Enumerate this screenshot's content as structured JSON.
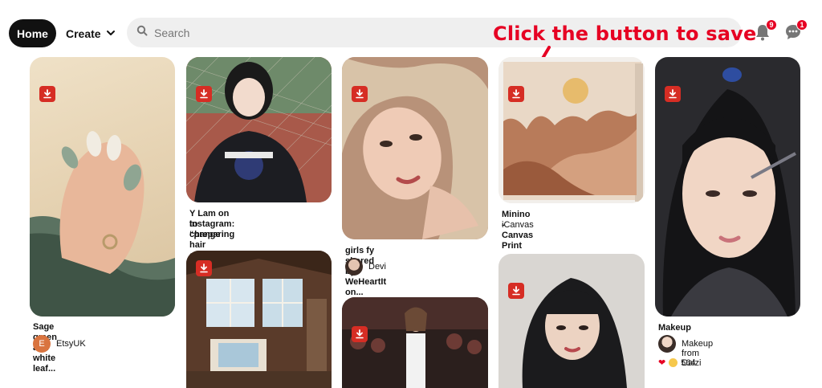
{
  "header": {
    "home_label": "Home",
    "create_label": "Create",
    "search_placeholder": "Search",
    "callout": "Click the button to save",
    "notifications_count": "9",
    "messages_count": "1"
  },
  "pins": [
    {
      "id": "pin1",
      "title": "Sage green and white leaf...",
      "source": "EtsyUK",
      "avatar_letter": "E"
    },
    {
      "id": "pin2",
      "title_line1": "Y Lam on Instagram: “preparing",
      "title_line2": "to change hair color..."
    },
    {
      "id": "pin3",
      "title": "girls fy shared by WeHeartIt on...",
      "source": "Devi"
    },
    {
      "id": "pin4",
      "title": "Minino - Canvas Print",
      "subtitle": "iCanvas"
    },
    {
      "id": "pin5",
      "title": "Makeup",
      "source": "Makeup from Caizi",
      "reactions": "564"
    },
    {
      "id": "pin6"
    },
    {
      "id": "pin7"
    },
    {
      "id": "pin8"
    }
  ],
  "colors": {
    "accent": "#e60023",
    "save_icon": "#d62d24",
    "search_bg": "#efefef"
  },
  "icons": {
    "save": "download-icon",
    "search": "search-icon",
    "notifications": "bell-icon",
    "messages": "chat-icon"
  }
}
